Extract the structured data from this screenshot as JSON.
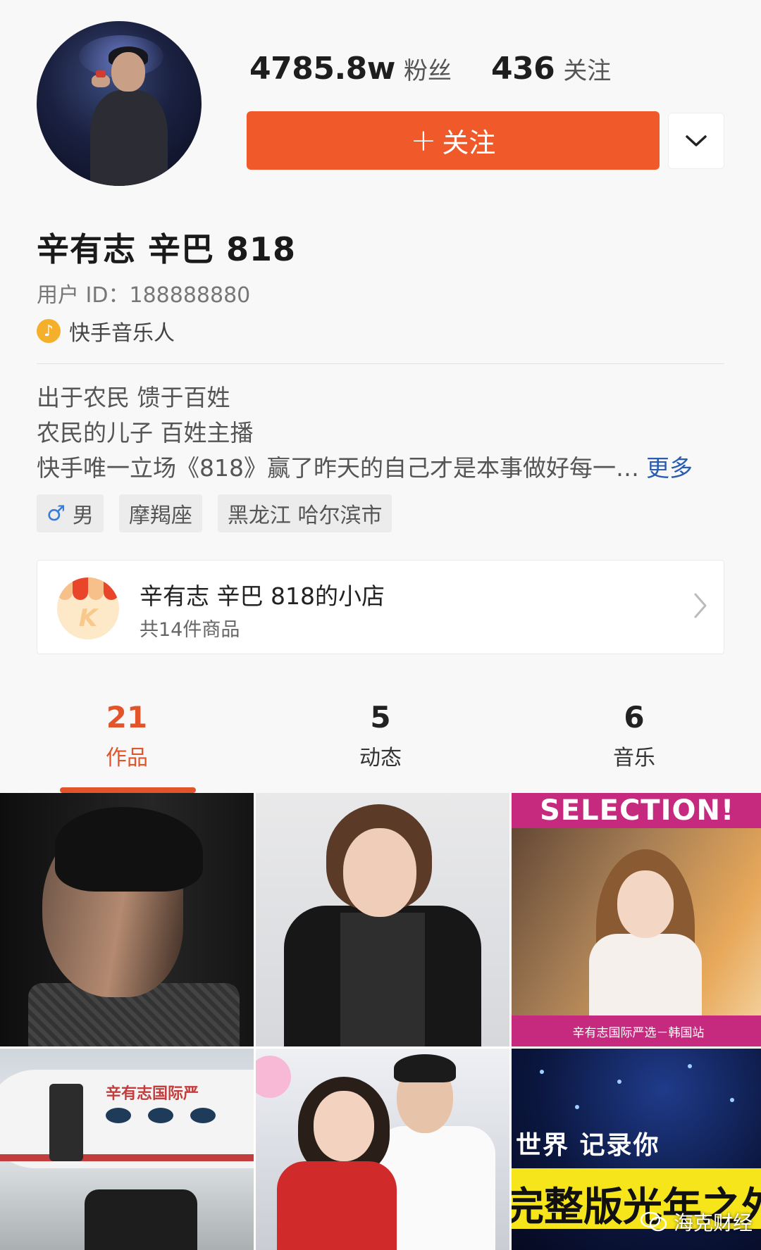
{
  "profile": {
    "fans_count": "4785.8w",
    "fans_label": "粉丝",
    "following_count": "436",
    "following_label": "关注",
    "follow_button_plus": "+",
    "follow_button_label": "关注",
    "name": "辛有志 辛巴 818",
    "user_id": "用户 ID：188888880",
    "badge_icon": "music-note-icon",
    "badge_label": "快手音乐人"
  },
  "bio": {
    "line1": "出于农民 馈于百姓",
    "line2": "农民的儿子  百姓主播",
    "line3": "快手唯一立场《818》赢了昨天的自己才是本事做好每一…",
    "more_label": "更多"
  },
  "tags": [
    {
      "icon": "male-icon",
      "glyph": "♂",
      "label": "男"
    },
    {
      "label": "摩羯座"
    },
    {
      "label": "黑龙江 哈尔滨市"
    }
  ],
  "shop": {
    "logo_letter": "K",
    "title": "辛有志 辛巴 818的小店",
    "subtitle": "共14件商品"
  },
  "tabs": [
    {
      "count": "21",
      "label": "作品",
      "active": true
    },
    {
      "count": "5",
      "label": "动态",
      "active": false
    },
    {
      "count": "6",
      "label": "音乐",
      "active": false
    }
  ],
  "grid": {
    "cell3_banner": "SELECTION!",
    "cell3_footer": "辛有志国际严选－韩国站",
    "cell4_text": "辛有志国际严",
    "cell6_line1": "世界  记录你",
    "cell6_line2": "完整版光年之外"
  },
  "watermark": "海克财经",
  "colors": {
    "accent": "#f05a2a",
    "tab_active": "#e2552b",
    "link": "#2a5db0"
  }
}
